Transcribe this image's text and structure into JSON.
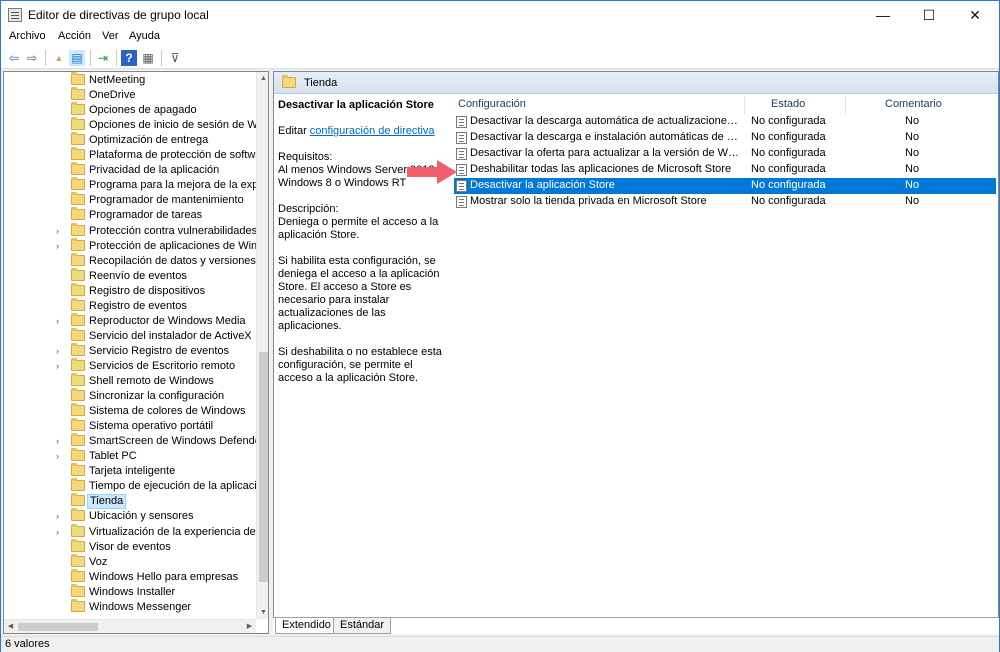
{
  "window": {
    "title": "Editor de directivas de grupo local",
    "controls": {
      "minimize": "—",
      "maximize": "☐",
      "close": "✕"
    }
  },
  "menu": [
    "Archivo",
    "Acción",
    "Ver",
    "Ayuda"
  ],
  "toolbar": {
    "icons": [
      "back-icon",
      "forward-icon",
      "up-folder-icon",
      "show-hide-tree-icon",
      "export-list-icon",
      "help-icon",
      "properties-icon",
      "filter-icon"
    ],
    "glyphs": {
      "back": "⇦",
      "forward": "⇨",
      "up": "▲",
      "tree": "▤",
      "export": "⇥",
      "help": "?",
      "props": "▦",
      "filter": "⊽"
    }
  },
  "tree": {
    "items": [
      {
        "label": "NetMeeting",
        "expandable": false
      },
      {
        "label": "OneDrive",
        "expandable": false
      },
      {
        "label": "Opciones de apagado",
        "expandable": false
      },
      {
        "label": "Opciones de inicio de sesión de Windo",
        "expandable": false
      },
      {
        "label": "Optimización de entrega",
        "expandable": false
      },
      {
        "label": "Plataforma de protección de software",
        "expandable": false
      },
      {
        "label": "Privacidad de la aplicación",
        "expandable": false
      },
      {
        "label": "Programa para la mejora de la experiei",
        "expandable": false
      },
      {
        "label": "Programador de mantenimiento",
        "expandable": false
      },
      {
        "label": "Programador de tareas",
        "expandable": false
      },
      {
        "label": "Protección contra vulnerabilidades de",
        "expandable": true
      },
      {
        "label": "Protección de aplicaciones de Windov",
        "expandable": true
      },
      {
        "label": "Recopilación de datos y versiones prel",
        "expandable": false
      },
      {
        "label": "Reenvío de eventos",
        "expandable": false
      },
      {
        "label": "Registro de dispositivos",
        "expandable": false
      },
      {
        "label": "Registro de eventos",
        "expandable": false
      },
      {
        "label": "Reproductor de Windows Media",
        "expandable": true
      },
      {
        "label": "Servicio del instalador de ActiveX",
        "expandable": false
      },
      {
        "label": "Servicio Registro de eventos",
        "expandable": true
      },
      {
        "label": "Servicios de Escritorio remoto",
        "expandable": true
      },
      {
        "label": "Shell remoto de Windows",
        "expandable": false
      },
      {
        "label": "Sincronizar la configuración",
        "expandable": false
      },
      {
        "label": "Sistema de colores de Windows",
        "expandable": false
      },
      {
        "label": "Sistema operativo portátil",
        "expandable": false
      },
      {
        "label": "SmartScreen de Windows Defender",
        "expandable": true
      },
      {
        "label": "Tablet PC",
        "expandable": true
      },
      {
        "label": "Tarjeta inteligente",
        "expandable": false
      },
      {
        "label": "Tiempo de ejecución de la aplicación",
        "expandable": false
      },
      {
        "label": "Tienda",
        "expandable": false,
        "selected": true
      },
      {
        "label": "Ubicación y sensores",
        "expandable": true
      },
      {
        "label": "Virtualización de la experiencia del usu",
        "expandable": true
      },
      {
        "label": "Visor de eventos",
        "expandable": false
      },
      {
        "label": "Voz",
        "expandable": false
      },
      {
        "label": "Windows Hello para empresas",
        "expandable": false
      },
      {
        "label": "Windows Installer",
        "expandable": false
      },
      {
        "label": "Windows Messenger",
        "expandable": false
      }
    ]
  },
  "right": {
    "header": "Tienda",
    "description": {
      "title": "Desactivar la aplicación Store",
      "edit_prefix": "Editar ",
      "edit_link": "configuración de directiva",
      "requirements": "Requisitos:\nAl menos Windows Server 2012, Windows 8 o Windows RT",
      "description": "Descripción:\nDeniega o permite el acceso a la aplicación Store.",
      "enabled": "Si habilita esta configuración, se deniega el acceso a la aplicación Store. El acceso a Store es necesario para instalar actualizaciones de las aplicaciones.",
      "disabled": "Si deshabilita o no establece esta configuración, se permite el acceso a la aplicación Store."
    },
    "columns": {
      "name": "Configuración",
      "state": "Estado",
      "comment": "Comentario"
    },
    "settings": [
      {
        "name": "Desactivar la descarga automática de actualizaciones en equ...",
        "state": "No configurada",
        "comment": "No"
      },
      {
        "name": "Desactivar la descarga e instalación automáticas de actualiz...",
        "state": "No configurada",
        "comment": "No"
      },
      {
        "name": "Desactivar la oferta para actualizar a la versión de Windows ...",
        "state": "No configurada",
        "comment": "No"
      },
      {
        "name": "Deshabilitar todas las aplicaciones de Microsoft Store",
        "state": "No configurada",
        "comment": "No"
      },
      {
        "name": "Desactivar la aplicación Store",
        "state": "No configurada",
        "comment": "No",
        "selected": true
      },
      {
        "name": "Mostrar solo la tienda privada en Microsoft Store",
        "state": "No configurada",
        "comment": "No"
      }
    ]
  },
  "tabs": [
    "Extendido",
    "Estándar"
  ],
  "status": "6 valores",
  "colors": {
    "selection": "#0078d7",
    "arrow": "#f2606e",
    "link": "#0066cc"
  }
}
